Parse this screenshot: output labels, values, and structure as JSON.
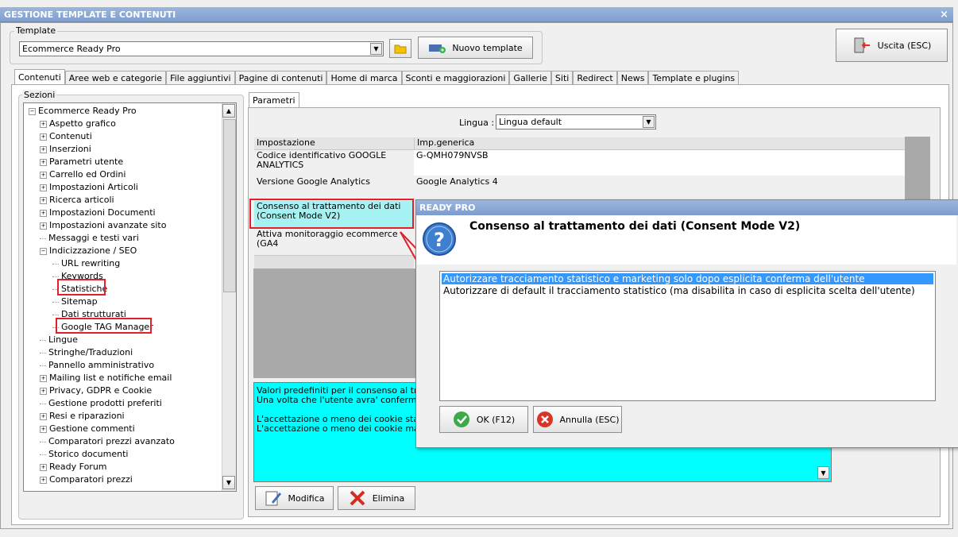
{
  "window": {
    "title": "GESTIONE TEMPLATE E CONTENUTI",
    "close": "×"
  },
  "template": {
    "legend": "Template",
    "value": "Ecommerce Ready Pro",
    "new_button": "Nuovo template"
  },
  "exit_button": "Uscita (ESC)",
  "tabs": [
    "Contenuti",
    "Aree web e categorie",
    "File aggiuntivi",
    "Pagine di contenuti",
    "Home di marca",
    "Sconti e maggiorazioni",
    "Gallerie",
    "Siti",
    "Redirect",
    "News",
    "Template e plugins"
  ],
  "sections": {
    "legend": "Sezioni",
    "root": "Ecommerce Ready Pro",
    "items": [
      {
        "label": "Aspetto grafico",
        "type": "plus",
        "level": 1
      },
      {
        "label": "Contenuti",
        "type": "plus",
        "level": 1
      },
      {
        "label": "Inserzioni",
        "type": "plus",
        "level": 1
      },
      {
        "label": "Parametri utente",
        "type": "plus",
        "level": 1
      },
      {
        "label": "Carrello ed Ordini",
        "type": "plus",
        "level": 1
      },
      {
        "label": "Impostazioni Articoli",
        "type": "plus",
        "level": 1
      },
      {
        "label": "Ricerca articoli",
        "type": "plus",
        "level": 1
      },
      {
        "label": "Impostazioni Documenti",
        "type": "plus",
        "level": 1
      },
      {
        "label": "Impostazioni avanzate sito",
        "type": "plus",
        "level": 1
      },
      {
        "label": "Messaggi e testi vari",
        "type": "leaf",
        "level": 1
      },
      {
        "label": "Indicizzazione / SEO",
        "type": "minus",
        "level": 1
      },
      {
        "label": "URL rewriting",
        "type": "leaf",
        "level": 2
      },
      {
        "label": "Keywords",
        "type": "leaf",
        "level": 2
      },
      {
        "label": "Statistiche",
        "type": "leaf",
        "level": 2
      },
      {
        "label": "Sitemap",
        "type": "leaf",
        "level": 2
      },
      {
        "label": "Dati strutturati",
        "type": "leaf",
        "level": 2
      },
      {
        "label": "Google TAG Manager",
        "type": "leaf",
        "level": 2
      },
      {
        "label": "Lingue",
        "type": "leaf",
        "level": 1
      },
      {
        "label": "Stringhe/Traduzioni",
        "type": "leaf",
        "level": 1
      },
      {
        "label": "Pannello amministrativo",
        "type": "leaf",
        "level": 1
      },
      {
        "label": "Mailing list e notifiche email",
        "type": "plus",
        "level": 1
      },
      {
        "label": "Privacy, GDPR e Cookie",
        "type": "plus",
        "level": 1
      },
      {
        "label": "Gestione prodotti preferiti",
        "type": "leaf",
        "level": 1
      },
      {
        "label": "Resi e riparazioni",
        "type": "plus",
        "level": 1
      },
      {
        "label": "Gestione commenti",
        "type": "plus",
        "level": 1
      },
      {
        "label": "Comparatori prezzi avanzato",
        "type": "leaf",
        "level": 1
      },
      {
        "label": "Storico documenti",
        "type": "leaf",
        "level": 1
      },
      {
        "label": "Ready Forum",
        "type": "plus",
        "level": 1
      },
      {
        "label": "Comparatori prezzi",
        "type": "plus",
        "level": 1
      }
    ]
  },
  "params": {
    "tab": "Parametri",
    "lingua_label": "Lingua :",
    "lingua_value": "Lingua default",
    "grid_header": [
      "Impostazione",
      "Imp.generica"
    ],
    "rows": [
      {
        "name": "Codice identificativo GOOGLE ANALYTICS",
        "value": "G-QMH079NVSB"
      },
      {
        "name": "Versione Google Analytics",
        "value": "Google Analytics 4"
      },
      {
        "name": "Consenso al trattamento dei dati (Consent Mode V2)",
        "value": ""
      },
      {
        "name": "Attiva monitoraggio ecommerce (GA4",
        "value": ""
      }
    ],
    "description": [
      "Valori predefiniti per il consenso al trattam",
      "Una volta che l'utente avra' confermato ur",
      "",
      "L'accettazione o meno dei cookie statistici",
      "L'accettazione o meno dei cookie marketin"
    ],
    "modify_button": "Modifica",
    "delete_button": "Elimina"
  },
  "dialog": {
    "title": "READY PRO",
    "heading": "Consenso al trattamento dei dati (Consent Mode V2)",
    "options": [
      "Autorizzare tracciamento statistico e marketing solo dopo esplicita conferma dell'utente",
      "Autorizzare di default il tracciamento statistico (ma disabilita in caso di esplicita scelta dell'utente)"
    ],
    "ok_button": "OK (F12)",
    "cancel_button": "Annulla (ESC)"
  },
  "colors": {
    "selection": "#3399ff",
    "highlight": "#00ffff",
    "annotation": "#e0202a"
  }
}
